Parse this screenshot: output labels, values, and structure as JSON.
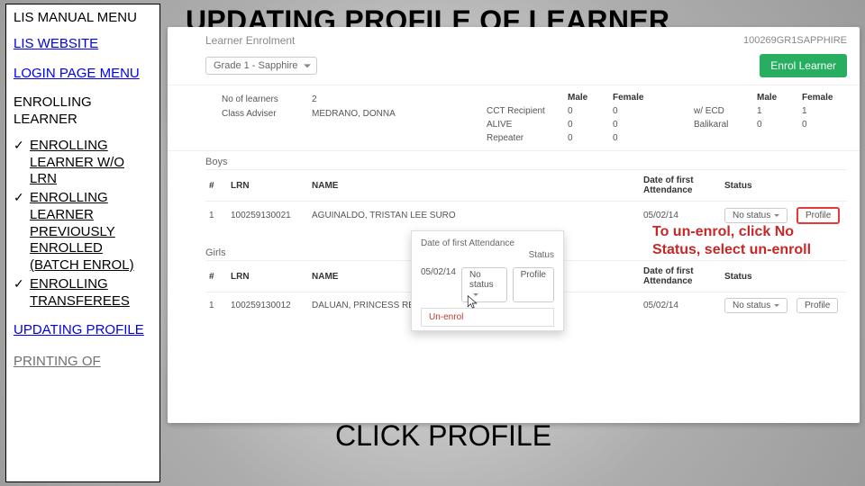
{
  "sidebar": {
    "manual_menu": "LIS MANUAL MENU",
    "website": "LIS WEBSITE",
    "login_page": "LOGIN PAGE MENU",
    "enrolling_learner": "ENROLLING LEARNER",
    "items": [
      {
        "label": "ENROLLING LEARNER W/O LRN"
      },
      {
        "label": "ENROLLING LEARNER PREVIOUSLY ENROLLED (BATCH ENROL)"
      },
      {
        "label": "ENROLLING TRANSFEREES"
      }
    ],
    "updating_profile": "UPDATING PROFILE",
    "printing_of": "PRINTING OF"
  },
  "slide_title": "UPDATING PROFILE OF LEARNER",
  "screenshot": {
    "crumb": "Learner Enrolment",
    "user_code": "100269GR1SAPPHIRE",
    "class_select": "Grade 1 - Sapphire",
    "enrol_btn": "Enrol Learner",
    "summary_left": [
      {
        "lbl": "No of learners",
        "val": "2"
      },
      {
        "lbl": "Class Adviser",
        "val": "MEDRANO, DONNA"
      }
    ],
    "summary_cols": [
      "",
      "Male",
      "Female",
      "",
      "",
      "Male",
      "Female"
    ],
    "summary_rows": [
      [
        "CCT Recipient",
        "0",
        "0",
        "",
        "w/ ECD",
        "1",
        "1"
      ],
      [
        "ALIVE",
        "0",
        "0",
        "",
        "Balikaral",
        "0",
        "0"
      ],
      [
        "Repeater",
        "0",
        "0",
        "",
        "",
        "",
        ""
      ]
    ],
    "boys_title": "Boys",
    "girls_title": "Girls",
    "table_headers": [
      "#",
      "LRN",
      "NAME",
      "Date of first Attendance",
      "Status",
      ""
    ],
    "boys_rows": [
      {
        "n": "1",
        "lrn": "100259130021",
        "name": "AGUINALDO, TRISTAN LEE SURO",
        "date": "05/02/14",
        "status": "No status",
        "profile": "Profile"
      }
    ],
    "girls_rows": [
      {
        "n": "1",
        "lrn": "100259130012",
        "name": "DALUAN, PRINCESS REGINE DUMAPAY",
        "date": "05/02/14",
        "status": "No status",
        "profile": "Profile"
      }
    ],
    "popup": {
      "label_date": "Date of first Attendance",
      "label_status": "Status",
      "date_value": "05/02/14",
      "status_btn": "No status",
      "profile_btn": "Profile",
      "menu_item": "Un-enrol"
    }
  },
  "callout": "To un-enrol, click No Status, select un-enroll",
  "click_profile": "CLICK PROFILE",
  "highlight_text": "(BATCH ENROL)"
}
